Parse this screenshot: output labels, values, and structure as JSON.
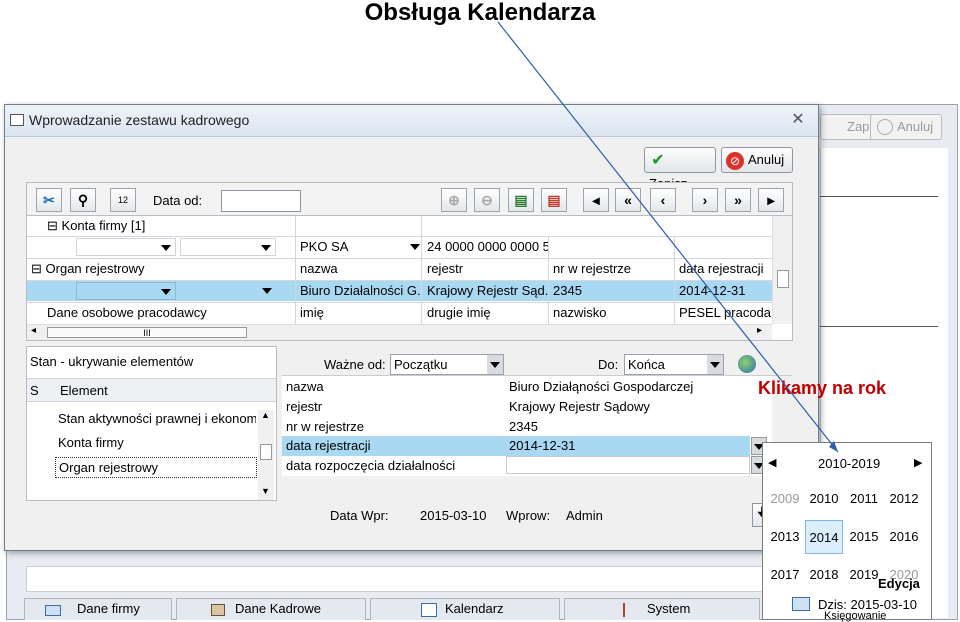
{
  "page_title": "Obsługa Kalendarza",
  "annotation": "Klikamy na rok",
  "background": {
    "save_label": "Zapisz",
    "cancel_label": "Anuluj"
  },
  "dialog": {
    "title": "Wprowadzanie zestawu kadrowego",
    "save_label": "Zapisz",
    "cancel_label": "Anuluj",
    "toolbar": {
      "date_from_label": "Data od:",
      "date_from_value": ""
    },
    "grid": {
      "rows": [
        {
          "c0": "Konta firmy [1]"
        },
        {
          "c1": "PKO SA",
          "c2": "24 0000 0000 0000 5..."
        },
        {
          "c0": "Organ rejestrowy",
          "c1": "nazwa",
          "c2": "rejestr",
          "c3": "nr w rejestrze",
          "c4": "data rejestracji"
        },
        {
          "c1": "Biuro Działalności G...",
          "c2": "Krajowy Rejestr Sąd...",
          "c3": "2345",
          "c4": "2014-12-31"
        },
        {
          "c0": "Dane osobowe pracodawcy",
          "c1": "imię",
          "c2": "drugie imię",
          "c3": "nazwisko",
          "c4": "PESEL pracodaw"
        }
      ],
      "scroll_mark": "III"
    },
    "left_panel": {
      "heading": "Stan - ukrywanie elementów",
      "col_s": "S",
      "col_element": "Element",
      "items": [
        "Stan aktywności prawnej i ekonom",
        "Konta firmy",
        "Organ rejestrowy"
      ]
    },
    "filter": {
      "valid_from_label": "Ważne od:",
      "valid_from_value": "Początku",
      "to_label": "Do:",
      "to_value": "Końca"
    },
    "details": [
      {
        "label": "nazwa",
        "value": "Biuro Działąności Gospodarczej"
      },
      {
        "label": "rejestr",
        "value": "Krajowy Rejestr Sądowy"
      },
      {
        "label": "nr w rejestrze",
        "value": "2345"
      },
      {
        "label": "data rejestracji",
        "value": "2014-12-31"
      },
      {
        "label": "data rozpoczęcia działalności",
        "value": ""
      }
    ],
    "footer": {
      "data_wpr_label": "Data Wpr:",
      "data_wpr_value": "2015-03-10",
      "wprow_label": "Wprow:",
      "wprow_value": "Admin"
    }
  },
  "calendar": {
    "decade": "2010-2019",
    "years": [
      "2009",
      "2010",
      "2011",
      "2012",
      "2013",
      "2014",
      "2015",
      "2016",
      "2017",
      "2018",
      "2019",
      "2020"
    ],
    "selected_year": "2014",
    "today_label": "Dzis: 2015-03-10"
  },
  "overlay_labels": {
    "edycja": "Edycja",
    "ksiegowanie": "Księgowanie"
  },
  "tabs": [
    "Dane firmy",
    "Dane Kadrowe",
    "Kalendarz",
    "System"
  ],
  "colors": {
    "selection": "#a9d8f2",
    "annotation": "#c00000",
    "arrow": "#2e5fa8"
  }
}
